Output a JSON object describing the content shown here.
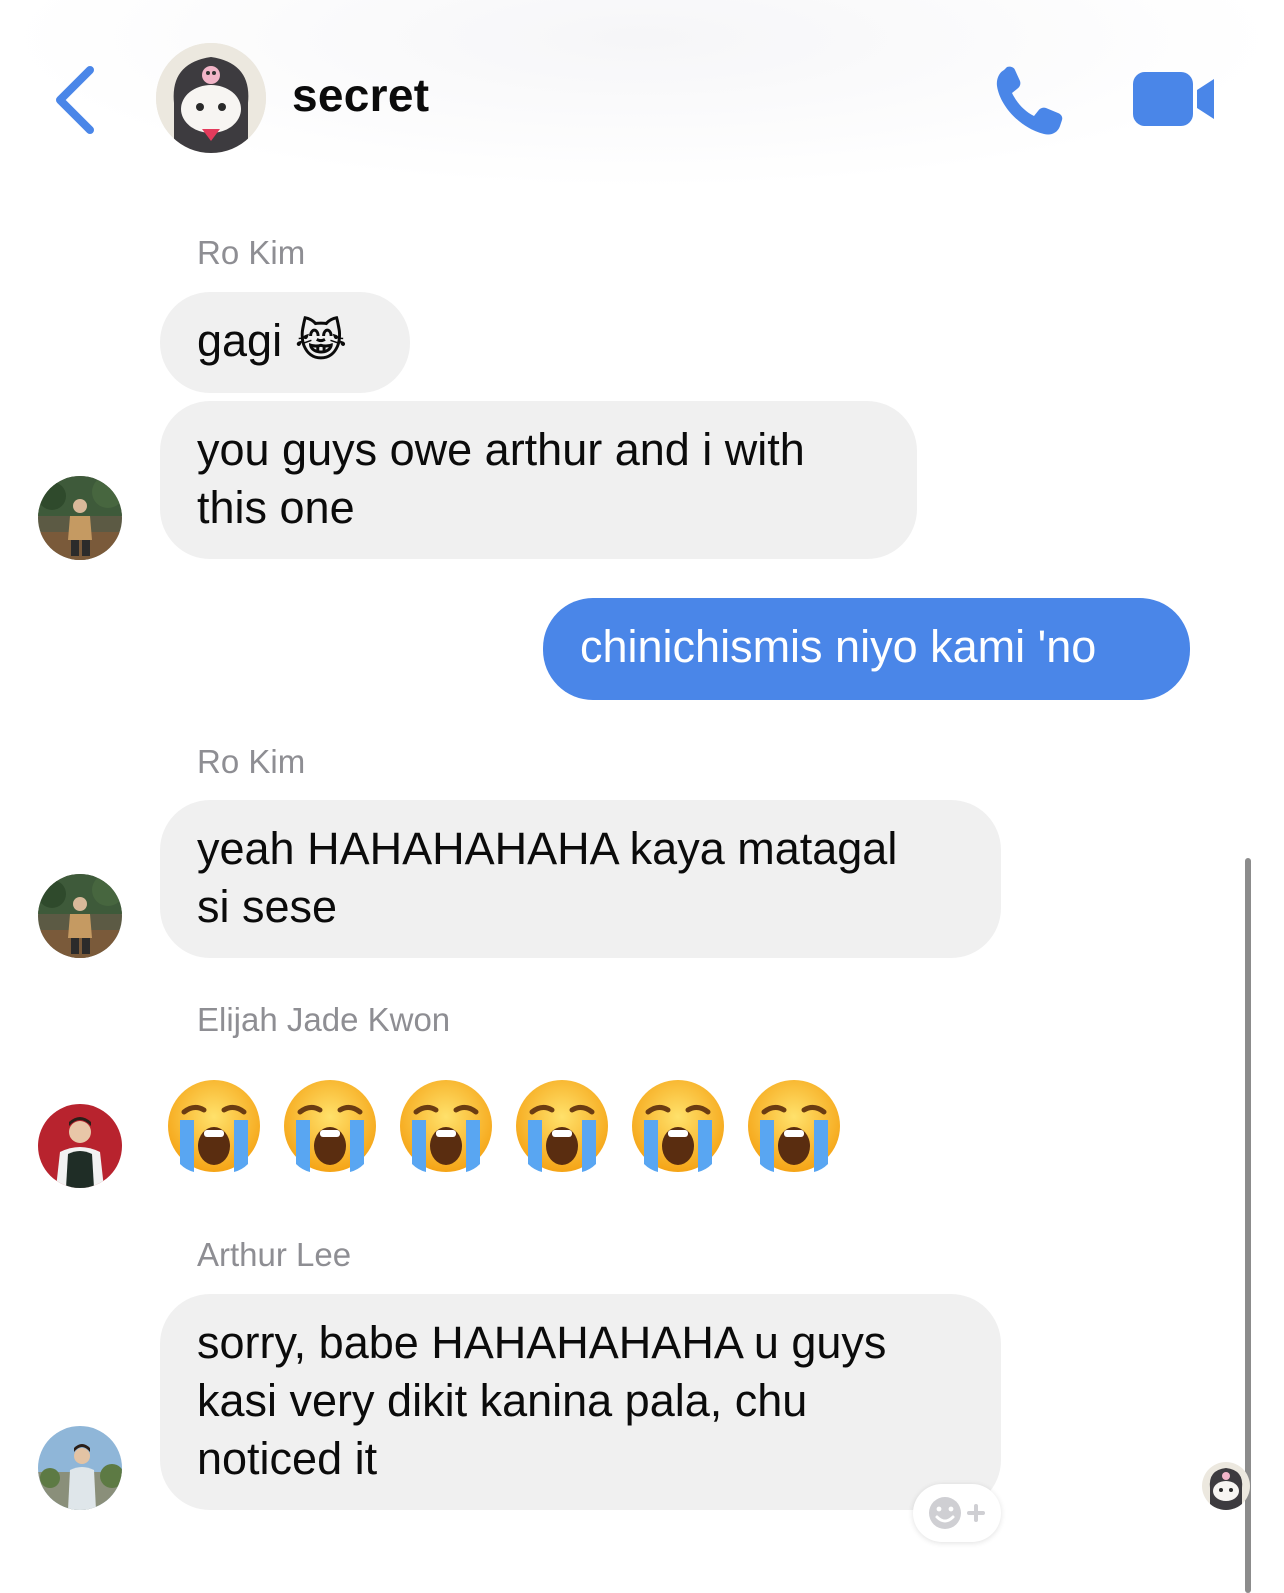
{
  "header": {
    "title": "secret",
    "back_icon": "chevron-left-icon",
    "call_icon": "phone-icon",
    "video_icon": "video-camera-icon",
    "accent_color": "#4a86e8"
  },
  "messages": [
    {
      "sender": "Ro Kim",
      "text": "gagi 😹"
    },
    {
      "text": "you guys owe arthur and i with\nthis one"
    },
    {
      "text": "chinichismis niyo kami 'no",
      "mine": true
    },
    {
      "sender": "Ro Kim",
      "text": "yeah HAHAHAHAHA kaya matagal\nsi sese"
    },
    {
      "sender": "Elijah Jade Kwon",
      "emoji": [
        "😭",
        "😭",
        "😭",
        "😭",
        "😭",
        "😭"
      ]
    },
    {
      "sender": "Arthur Lee",
      "text": "sorry, babe HAHAHAHAHA u guys\nkasi very dikit kanina pala, chu\nnoticed it"
    }
  ],
  "reaction_icon": "add-reaction-icon"
}
